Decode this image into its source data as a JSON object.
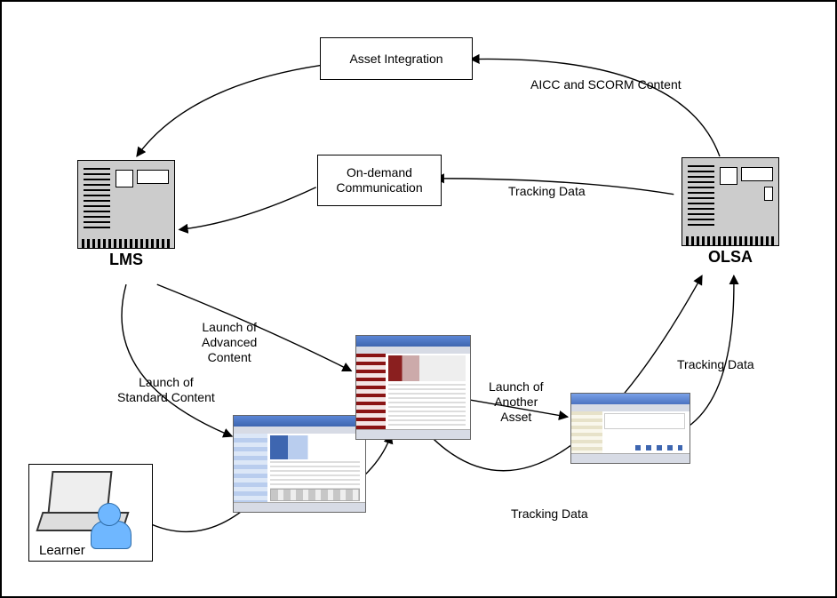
{
  "nodes": {
    "asset_integration": "Asset Integration",
    "on_demand_comm": "On-demand\nCommunication",
    "lms_label": "LMS",
    "olsa_label": "OLSA",
    "learner_label": "Learner"
  },
  "edges": {
    "aicc_scorm": "AICC and SCORM Content",
    "tracking_top": "Tracking Data",
    "launch_advanced": "Launch of\nAdvanced\nContent",
    "launch_standard": "Launch of\nStandard Content",
    "launch_another": "Launch of\nAnother\nAsset",
    "tracking_right": "Tracking Data",
    "tracking_bottom": "Tracking Data"
  }
}
